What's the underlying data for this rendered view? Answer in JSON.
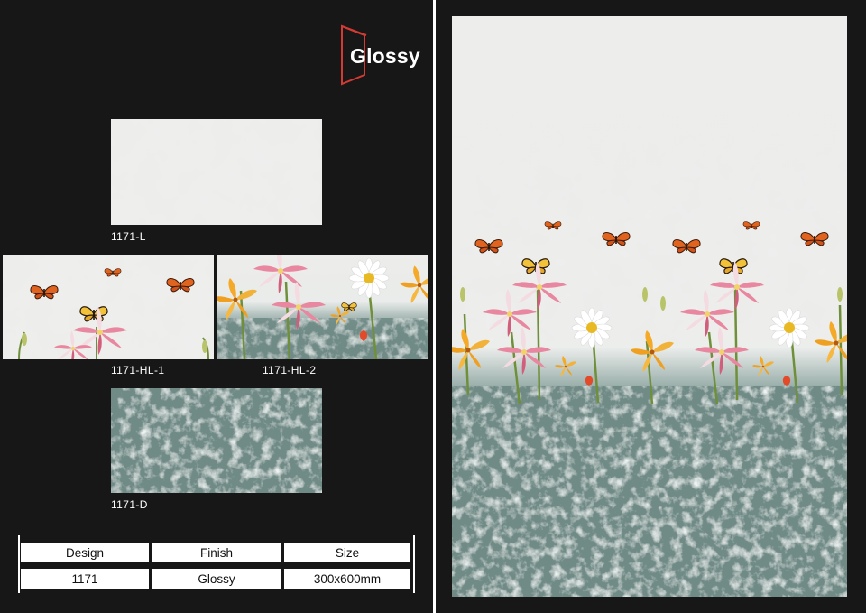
{
  "badge": {
    "label": "Glossy",
    "accent": "#d23a33"
  },
  "tiles": {
    "light": {
      "label": "1171-L"
    },
    "highlighter_1": {
      "label": "1171-HL-1"
    },
    "highlighter_2": {
      "label": "1171-HL-2"
    },
    "dark": {
      "label": "1171-D"
    }
  },
  "spec_table": {
    "headers": [
      "Design",
      "Finish",
      "Size"
    ],
    "values": [
      "1171",
      "Glossy",
      "300x600mm"
    ]
  },
  "colors": {
    "background": "#171717",
    "marble": "#ededeb",
    "stone": "#6f8b86"
  }
}
